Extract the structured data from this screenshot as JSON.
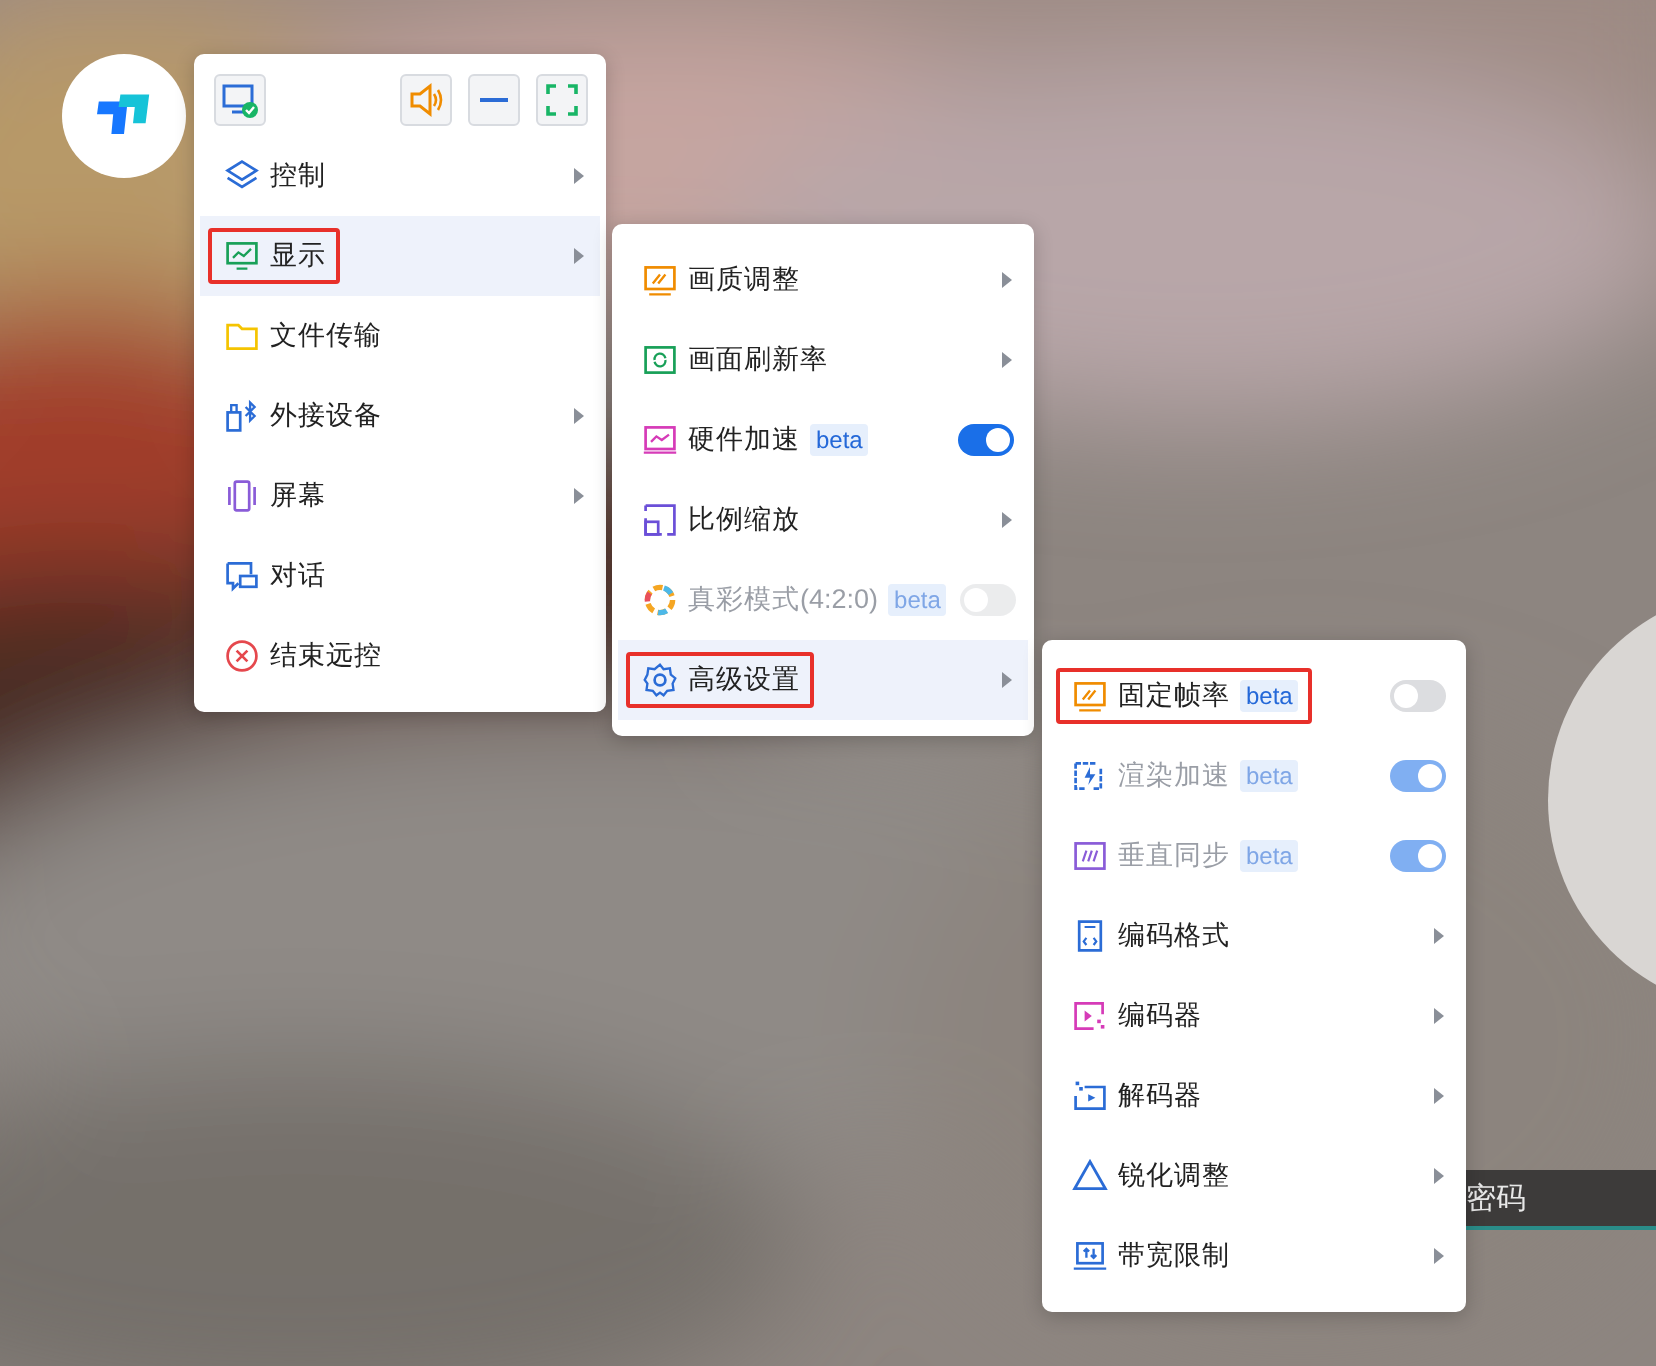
{
  "remote_bar": {
    "text": "密码"
  },
  "main_menu": {
    "toolbar": [
      {
        "kind": "status"
      },
      {
        "kind": "sound"
      },
      {
        "kind": "minimize"
      },
      {
        "kind": "fullscreen"
      }
    ],
    "items": [
      {
        "label": "控制",
        "kind": "submenu",
        "selected": false,
        "highlighted": false
      },
      {
        "label": "显示",
        "kind": "submenu",
        "selected": true,
        "highlighted": true
      },
      {
        "label": "文件传输",
        "kind": "action",
        "selected": false,
        "highlighted": false
      },
      {
        "label": "外接设备",
        "kind": "submenu",
        "selected": false,
        "highlighted": false
      },
      {
        "label": "屏幕",
        "kind": "submenu",
        "selected": false,
        "highlighted": false
      },
      {
        "label": "对话",
        "kind": "action",
        "selected": false,
        "highlighted": false
      },
      {
        "label": "结束远控",
        "kind": "action",
        "selected": false,
        "highlighted": false
      }
    ]
  },
  "display_menu": {
    "items": [
      {
        "label": "画质调整",
        "kind": "submenu",
        "selected": false,
        "highlighted": false,
        "disabled": false
      },
      {
        "label": "画面刷新率",
        "kind": "submenu",
        "selected": false,
        "highlighted": false,
        "disabled": false
      },
      {
        "label": "硬件加速",
        "kind": "toggle",
        "badge": "beta",
        "on": true,
        "selected": false,
        "highlighted": false,
        "disabled": false
      },
      {
        "label": "比例缩放",
        "kind": "submenu",
        "selected": false,
        "highlighted": false,
        "disabled": false
      },
      {
        "label": "真彩模式(4:2:0)",
        "kind": "toggle",
        "badge": "beta",
        "on": false,
        "selected": false,
        "highlighted": false,
        "disabled": true
      },
      {
        "label": "高级设置",
        "kind": "submenu",
        "selected": true,
        "highlighted": true,
        "disabled": false
      }
    ]
  },
  "advanced_menu": {
    "items": [
      {
        "label": "固定帧率",
        "kind": "toggle",
        "badge": "beta",
        "on": false,
        "selected": false,
        "highlighted": true,
        "disabled": false
      },
      {
        "label": "渲染加速",
        "kind": "toggle",
        "badge": "beta",
        "on": true,
        "selected": false,
        "highlighted": false,
        "disabled": true
      },
      {
        "label": "垂直同步",
        "kind": "toggle",
        "badge": "beta",
        "on": true,
        "selected": false,
        "highlighted": false,
        "disabled": true
      },
      {
        "label": "编码格式",
        "kind": "submenu",
        "selected": false,
        "highlighted": false,
        "disabled": false
      },
      {
        "label": "编码器",
        "kind": "submenu",
        "selected": false,
        "highlighted": false,
        "disabled": false
      },
      {
        "label": "解码器",
        "kind": "submenu",
        "selected": false,
        "highlighted": false,
        "disabled": false
      },
      {
        "label": "锐化调整",
        "kind": "submenu",
        "selected": false,
        "highlighted": false,
        "disabled": false
      },
      {
        "label": "带宽限制",
        "kind": "submenu",
        "selected": false,
        "highlighted": false,
        "disabled": false
      }
    ]
  }
}
